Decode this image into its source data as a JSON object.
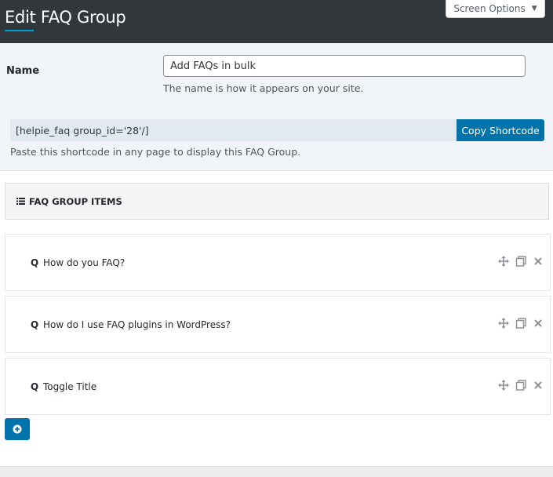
{
  "header": {
    "title": "Edit FAQ Group",
    "screen_options_label": "Screen Options",
    "accent_color": "#00a0d2",
    "background_color": "#32373c"
  },
  "form": {
    "name_label": "Name",
    "name_value": "Add FAQs in bulk",
    "name_description": "The name is how it appears on your site.",
    "shortcode_value": "[helpie_faq group_id='28'/]",
    "copy_button_label": "Copy Shortcode",
    "shortcode_description": "Paste this shortcode in any page to display this FAQ Group."
  },
  "group": {
    "header_label": "FAQ GROUP ITEMS",
    "header_icon": "list-icon",
    "items": [
      {
        "q_marker": "Q",
        "title": "How do you FAQ?"
      },
      {
        "q_marker": "Q",
        "title": "How do I use FAQ plugins in WordPress?"
      },
      {
        "q_marker": "Q",
        "title": "Toggle Title"
      }
    ],
    "item_actions": [
      "move-icon",
      "duplicate-icon",
      "close-icon"
    ],
    "add_button_icon": "plus-circle-icon",
    "primary_color": "#0073aa"
  }
}
